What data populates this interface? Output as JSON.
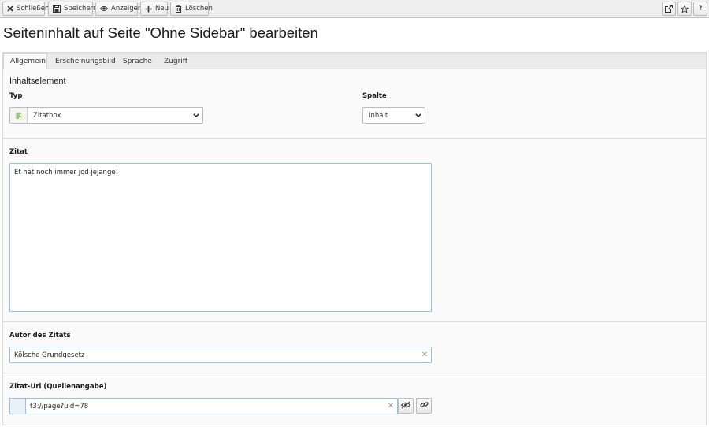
{
  "toolbar": {
    "close_label": "Schließen",
    "save_label": "Speichern",
    "view_label": "Anzeigen",
    "new_label": "Neu",
    "delete_label": "Löschen",
    "help_label": "?"
  },
  "page": {
    "title": "Seiteninhalt auf Seite \"Ohne Sidebar\" bearbeiten"
  },
  "tabs": [
    {
      "label": "Allgemein",
      "active": true
    },
    {
      "label": "Erscheinungsbild",
      "active": false
    },
    {
      "label": "Sprache",
      "active": false
    },
    {
      "label": "Zugriff",
      "active": false
    }
  ],
  "content_element": {
    "heading": "Inhaltselement",
    "type_label": "Typ",
    "type_value": "Zitatbox",
    "column_label": "Spalte",
    "column_value": "Inhalt"
  },
  "quote": {
    "label": "Zitat",
    "value": "Et hät noch immer jod jejange!"
  },
  "author": {
    "label": "Autor des Zitats",
    "value": "Kölsche Grundgesetz"
  },
  "url": {
    "label": "Zitat-Url (Quellenangabe)",
    "value": "t3://page?uid=78"
  },
  "colors": {
    "focus_border": "#97c1e6",
    "toolbar_bg": "#eeeeee"
  }
}
